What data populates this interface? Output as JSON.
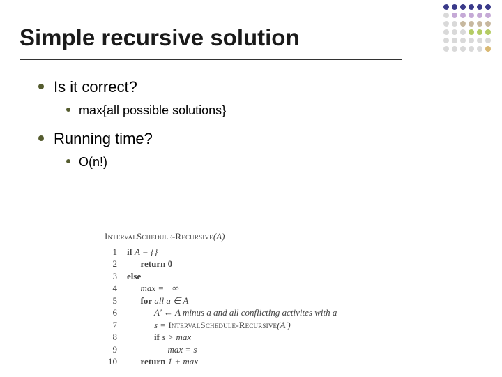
{
  "title": "Simple recursive solution",
  "bullets": {
    "b1": {
      "label": "Is it correct?"
    },
    "b1a": {
      "label": "max{all possible solutions}"
    },
    "b2": {
      "label": "Running time?"
    },
    "b2a": {
      "label": "O(n!)"
    }
  },
  "algo": {
    "name_sc": "IntervalSchedule-Recursive",
    "name_arg": "(A)",
    "lines": {
      "l1": {
        "num": "1",
        "kw": "if",
        "rest": " A = {}"
      },
      "l2": {
        "num": "2",
        "ret": "return 0"
      },
      "l3": {
        "num": "3",
        "kw": "else",
        "rest": ""
      },
      "l4": {
        "num": "4",
        "body": "max = −∞"
      },
      "l5": {
        "num": "5",
        "kw": "for",
        "rest": " all a ∈ A"
      },
      "l6": {
        "num": "6",
        "body_pre": "A′ ← A minus a and all conflicting activites with a"
      },
      "l7": {
        "num": "7",
        "body_pre": "s = ",
        "sc": "IntervalSchedule-Recursive",
        "body_post": "(A′)"
      },
      "l8": {
        "num": "8",
        "kw": "if",
        "rest": " s > max"
      },
      "l9": {
        "num": "9",
        "body": "max = s"
      },
      "l10": {
        "num": "10",
        "kw": "return",
        "rest": " 1 + max"
      }
    }
  }
}
